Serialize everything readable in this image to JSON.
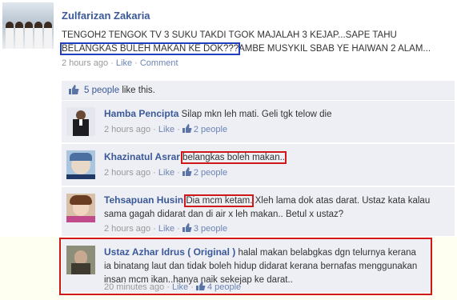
{
  "post": {
    "author": "Zulfarizan Zakaria",
    "text_part1": "TENGOH2 TENGOK TV 3 SUKU TAKDI TGOK MAJALAH 3 KEJAP...SAPE TAHU",
    "text_highlight": "BELANGKAS BULEH MAKAN KE DOK???",
    "text_part2": "AMBE MUSYKIL SBAB YE HAIWAN 2 ALAM...",
    "time": "2 hours ago",
    "sep": " · ",
    "like_label": "Like",
    "comment_label": "Comment"
  },
  "likes": {
    "count_link": "5 people",
    "suffix": " like this."
  },
  "comments": [
    {
      "author": "Hamba Pencipta",
      "text_pre": " Silap mkn leh mati. Geli tgk telow die",
      "time": "2 hours ago",
      "like_label": "Like",
      "likes": "2 people"
    },
    {
      "author": "Khazinatul Asrar",
      "text_highlight": "belangkas boleh makan..",
      "time": "2 hours ago",
      "like_label": "Like",
      "likes": "2 people"
    },
    {
      "author": "Tehsapuan Husin",
      "text_highlight": "Dia mcm ketam.",
      "text_post": " Xleh lama dok atas darat. Ustaz kata kalau sama gagah didarat dan di air x leh makan.. Betul x ustaz?",
      "time": "2 hours ago",
      "like_label": "Like",
      "likes": "3 people"
    },
    {
      "author": "Ustaz Azhar Idrus ( Original )",
      "text_post": " halal makan belabgkas dgn telurnya kerana ia binatang laut dan tidak boleh hidup didarat kerana bernafas menggunakan insan mcm ikan..hanya naik sekejap ke darat..",
      "time": "20 minutes ago",
      "like_label": "Like",
      "likes": "4 people"
    }
  ],
  "colors": {
    "link": "#3b5998",
    "highlight_red": "#d01818",
    "highlight_blue": "#1f3fbf",
    "comment_bg": "#edeff4"
  }
}
